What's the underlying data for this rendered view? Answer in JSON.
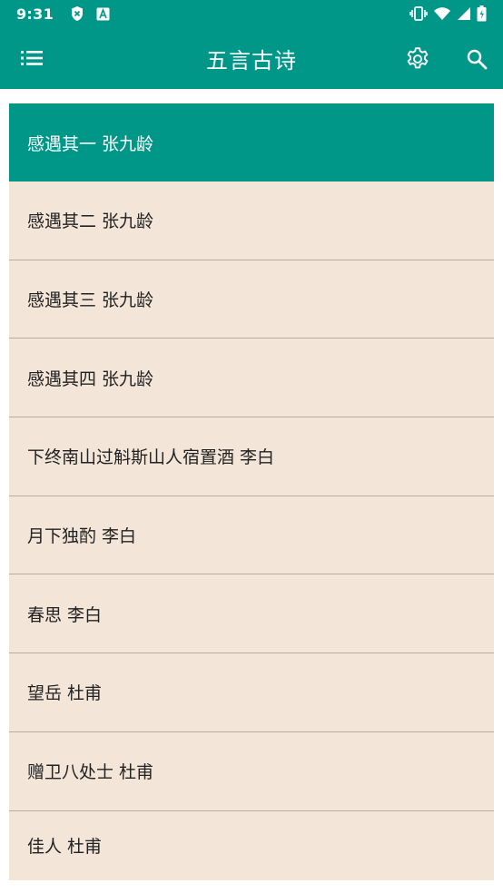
{
  "status_bar": {
    "time": "9:31"
  },
  "app_bar": {
    "title": "五言古诗"
  },
  "poems": [
    {
      "label": "感遇其一 张九龄",
      "selected": true
    },
    {
      "label": "感遇其二 张九龄"
    },
    {
      "label": "感遇其三 张九龄"
    },
    {
      "label": "感遇其四 张九龄"
    },
    {
      "label": "下终南山过斛斯山人宿置酒 李白"
    },
    {
      "label": "月下独酌 李白"
    },
    {
      "label": "春思 李白"
    },
    {
      "label": "望岳 杜甫"
    },
    {
      "label": "赠卫八处士 杜甫"
    },
    {
      "label": "佳人 杜甫"
    }
  ],
  "colors": {
    "primary": "#009688",
    "list_background": "#f3e6d9",
    "divider": "#b8aca1"
  },
  "icons": [
    "menu-icon",
    "settings-gear-icon",
    "search-icon",
    "shield-x-icon",
    "a-box-icon",
    "vibrate-icon",
    "wifi-icon",
    "signal-icon",
    "battery-icon"
  ]
}
